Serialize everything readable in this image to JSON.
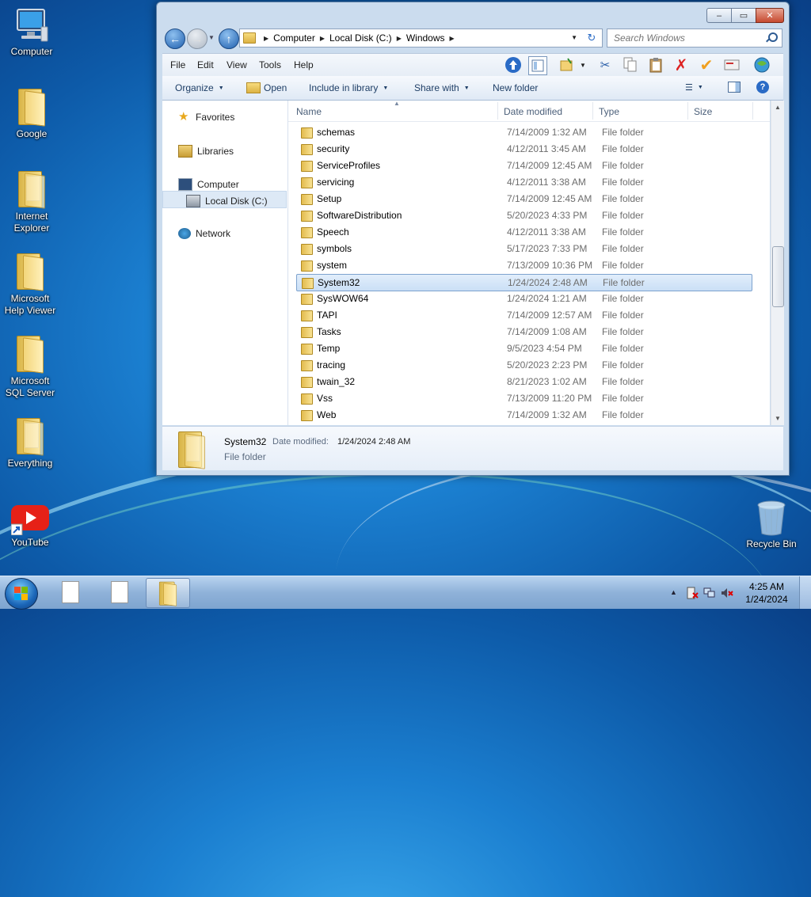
{
  "desktop": {
    "icons": [
      {
        "label": "Computer"
      },
      {
        "label": "Google"
      },
      {
        "label": "Internet Explorer"
      },
      {
        "label": "Microsoft Help Viewer"
      },
      {
        "label": "Microsoft SQL Server"
      },
      {
        "label": "Everything"
      },
      {
        "label": "YouTube"
      },
      {
        "label": "Recycle Bin"
      }
    ]
  },
  "window": {
    "caption": {
      "minimize": "–",
      "maximize": "▭",
      "close": "✕"
    },
    "address": {
      "crumbs": [
        "Computer",
        "Local Disk (C:)",
        "Windows"
      ]
    },
    "search": {
      "placeholder": "Search Windows"
    },
    "menu": [
      "File",
      "Edit",
      "View",
      "Tools",
      "Help"
    ],
    "commands": {
      "organize": "Organize",
      "open": "Open",
      "include": "Include in library",
      "share": "Share with",
      "new_folder": "New folder"
    },
    "nav": {
      "favorites": "Favorites",
      "libraries": "Libraries",
      "computer": "Computer",
      "local_disk": "Local Disk (C:)",
      "network": "Network"
    },
    "columns": {
      "name": "Name",
      "date": "Date modified",
      "type": "Type",
      "size": "Size"
    },
    "files": [
      {
        "name": "schemas",
        "date": "7/14/2009 1:32 AM",
        "type": "File folder"
      },
      {
        "name": "security",
        "date": "4/12/2011 3:45 AM",
        "type": "File folder"
      },
      {
        "name": "ServiceProfiles",
        "date": "7/14/2009 12:45 AM",
        "type": "File folder"
      },
      {
        "name": "servicing",
        "date": "4/12/2011 3:38 AM",
        "type": "File folder"
      },
      {
        "name": "Setup",
        "date": "7/14/2009 12:45 AM",
        "type": "File folder"
      },
      {
        "name": "SoftwareDistribution",
        "date": "5/20/2023 4:33 PM",
        "type": "File folder"
      },
      {
        "name": "Speech",
        "date": "4/12/2011 3:38 AM",
        "type": "File folder"
      },
      {
        "name": "symbols",
        "date": "5/17/2023 7:33 PM",
        "type": "File folder"
      },
      {
        "name": "system",
        "date": "7/13/2009 10:36 PM",
        "type": "File folder"
      },
      {
        "name": "System32",
        "date": "1/24/2024 2:48 AM",
        "type": "File folder"
      },
      {
        "name": "SysWOW64",
        "date": "1/24/2024 1:21 AM",
        "type": "File folder"
      },
      {
        "name": "TAPI",
        "date": "7/14/2009 12:57 AM",
        "type": "File folder"
      },
      {
        "name": "Tasks",
        "date": "7/14/2009 1:08 AM",
        "type": "File folder"
      },
      {
        "name": "Temp",
        "date": "9/5/2023 4:54 PM",
        "type": "File folder"
      },
      {
        "name": "tracing",
        "date": "5/20/2023 2:23 PM",
        "type": "File folder"
      },
      {
        "name": "twain_32",
        "date": "8/21/2023 1:02 AM",
        "type": "File folder"
      },
      {
        "name": "Vss",
        "date": "7/13/2009 11:20 PM",
        "type": "File folder"
      },
      {
        "name": "Web",
        "date": "7/14/2009 1:32 AM",
        "type": "File folder"
      }
    ],
    "selected_index": 9,
    "details": {
      "name": "System32",
      "date_label": "Date modified:",
      "date_value": "1/24/2024 2:48 AM",
      "type": "File folder"
    }
  },
  "taskbar": {
    "clock_time": "4:25 AM",
    "clock_date": "1/24/2024",
    "tray_overflow": "▲"
  },
  "colors": {
    "accent": "#1b66b8",
    "selection": "#cadff6",
    "taskbar": "#8fb2d9"
  }
}
